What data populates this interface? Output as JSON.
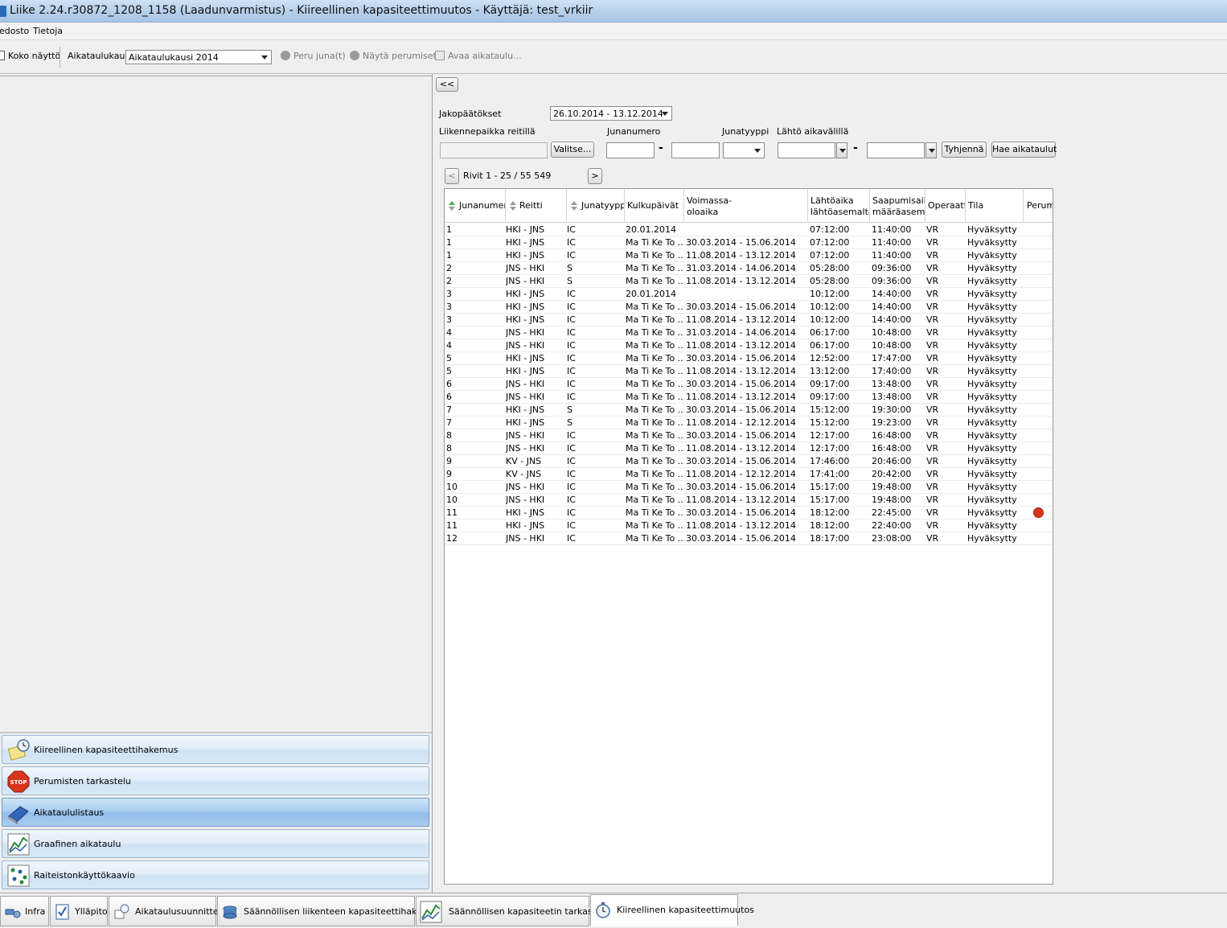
{
  "window": {
    "title": "Liike 2.24.r30872_1208_1158 (Laadunvarmistus) - Kiireellinen kapasiteettimuutos - Käyttäjä: test_vrkiir"
  },
  "menu": {
    "items": [
      "edosto",
      "Tietoja"
    ]
  },
  "toolbar": {
    "fullscreen_label": "Koko näyttö",
    "season_label": "Aikataulukausi",
    "season_value": "Aikataulukausi 2014",
    "cancel_train_label": "Peru juna(t)",
    "show_cancellations_label": "Näytä perumiset",
    "open_timetable_label": "Avaa aikataulu..."
  },
  "left_nav": {
    "items": [
      {
        "label": "Kiireellinen kapasiteettihakemus",
        "icon": "notepad-clock-icon",
        "active": false
      },
      {
        "label": "Perumisten tarkastelu",
        "icon": "stop-sign-icon",
        "active": false
      },
      {
        "label": "Aikataululistaus",
        "icon": "book-icon",
        "active": true
      },
      {
        "label": "Graafinen aikataulu",
        "icon": "graph-icon",
        "active": false
      },
      {
        "label": "Raiteistonkäyttökaavio",
        "icon": "dots-grid-icon",
        "active": false
      }
    ]
  },
  "search": {
    "collapse_label": "<<",
    "decisions_label": "Jakopäätökset",
    "decisions_value": "26.10.2014 - 13.12.2014",
    "location_label": "Liikennepaikka reitillä",
    "choose_button": "Valitse...",
    "train_number_label": "Junanumero",
    "train_type_label": "Junatyyppi",
    "departure_range_label": "Lähtö aikavälillä",
    "dash": "-",
    "clear_button": "Tyhjennä",
    "search_button": "Hae aikataulut"
  },
  "pager": {
    "prev": "<",
    "next": ">",
    "text": "Rivit 1 - 25 / 55 549"
  },
  "table": {
    "columns": [
      "Junanumero",
      "Reitti",
      "Junatyyppi",
      "Kulkupäivät",
      "Voimassa-|oloaika",
      "Lähtöaika|lähtöasemalta",
      "Saapumisaika|määräasemal",
      "Operaatto",
      "Tila",
      "Perum"
    ],
    "rows": [
      [
        "1",
        "HKI - JNS",
        "IC",
        "20.01.2014",
        "",
        "07:12:00",
        "11:40:00",
        "VR",
        "Hyväksytty",
        ""
      ],
      [
        "1",
        "HKI - JNS",
        "IC",
        "Ma Ti Ke To ...",
        "30.03.2014 - 15.06.2014",
        "07:12:00",
        "11:40:00",
        "VR",
        "Hyväksytty",
        ""
      ],
      [
        "1",
        "HKI - JNS",
        "IC",
        "Ma Ti Ke To ...",
        "11.08.2014 - 13.12.2014",
        "07:12:00",
        "11:40:00",
        "VR",
        "Hyväksytty",
        ""
      ],
      [
        "2",
        "JNS - HKI",
        "S",
        "Ma Ti Ke To ...",
        "31.03.2014 - 14.06.2014",
        "05:28:00",
        "09:36:00",
        "VR",
        "Hyväksytty",
        ""
      ],
      [
        "2",
        "JNS - HKI",
        "S",
        "Ma Ti Ke To ...",
        "11.08.2014 - 13.12.2014",
        "05:28:00",
        "09:36:00",
        "VR",
        "Hyväksytty",
        ""
      ],
      [
        "3",
        "HKI - JNS",
        "IC",
        "20.01.2014",
        "",
        "10:12:00",
        "14:40:00",
        "VR",
        "Hyväksytty",
        ""
      ],
      [
        "3",
        "HKI - JNS",
        "IC",
        "Ma Ti Ke To ...",
        "30.03.2014 - 15.06.2014",
        "10:12:00",
        "14:40:00",
        "VR",
        "Hyväksytty",
        ""
      ],
      [
        "3",
        "HKI - JNS",
        "IC",
        "Ma Ti Ke To ...",
        "11.08.2014 - 13.12.2014",
        "10:12:00",
        "14:40:00",
        "VR",
        "Hyväksytty",
        ""
      ],
      [
        "4",
        "JNS - HKI",
        "IC",
        "Ma Ti Ke To ...",
        "31.03.2014 - 14.06.2014",
        "06:17:00",
        "10:48:00",
        "VR",
        "Hyväksytty",
        ""
      ],
      [
        "4",
        "JNS - HKI",
        "IC",
        "Ma Ti Ke To ...",
        "11.08.2014 - 13.12.2014",
        "06:17:00",
        "10:48:00",
        "VR",
        "Hyväksytty",
        ""
      ],
      [
        "5",
        "HKI - JNS",
        "IC",
        "Ma Ti Ke To ...",
        "30.03.2014 - 15.06.2014",
        "12:52:00",
        "17:47:00",
        "VR",
        "Hyväksytty",
        ""
      ],
      [
        "5",
        "HKI - JNS",
        "IC",
        "Ma Ti Ke To ...",
        "11.08.2014 - 13.12.2014",
        "13:12:00",
        "17:40:00",
        "VR",
        "Hyväksytty",
        ""
      ],
      [
        "6",
        "JNS - HKI",
        "IC",
        "Ma Ti Ke To ...",
        "30.03.2014 - 15.06.2014",
        "09:17:00",
        "13:48:00",
        "VR",
        "Hyväksytty",
        ""
      ],
      [
        "6",
        "JNS - HKI",
        "IC",
        "Ma Ti Ke To ...",
        "11.08.2014 - 13.12.2014",
        "09:17:00",
        "13:48:00",
        "VR",
        "Hyväksytty",
        ""
      ],
      [
        "7",
        "HKI - JNS",
        "S",
        "Ma Ti Ke To ...",
        "30.03.2014 - 15.06.2014",
        "15:12:00",
        "19:30:00",
        "VR",
        "Hyväksytty",
        ""
      ],
      [
        "7",
        "HKI - JNS",
        "S",
        "Ma Ti Ke To ...",
        "11.08.2014 - 12.12.2014",
        "15:12:00",
        "19:23:00",
        "VR",
        "Hyväksytty",
        ""
      ],
      [
        "8",
        "JNS - HKI",
        "IC",
        "Ma Ti Ke To ...",
        "30.03.2014 - 15.06.2014",
        "12:17:00",
        "16:48:00",
        "VR",
        "Hyväksytty",
        ""
      ],
      [
        "8",
        "JNS - HKI",
        "IC",
        "Ma Ti Ke To ...",
        "11.08.2014 - 13.12.2014",
        "12:17:00",
        "16:48:00",
        "VR",
        "Hyväksytty",
        ""
      ],
      [
        "9",
        "KV - JNS",
        "IC",
        "Ma Ti Ke To ...",
        "30.03.2014 - 15.06.2014",
        "17:46:00",
        "20:46:00",
        "VR",
        "Hyväksytty",
        ""
      ],
      [
        "9",
        "KV - JNS",
        "IC",
        "Ma Ti Ke To ...",
        "11.08.2014 - 12.12.2014",
        "17:41:00",
        "20:42:00",
        "VR",
        "Hyväksytty",
        ""
      ],
      [
        "10",
        "JNS - HKI",
        "IC",
        "Ma Ti Ke To ...",
        "30.03.2014 - 15.06.2014",
        "15:17:00",
        "19:48:00",
        "VR",
        "Hyväksytty",
        ""
      ],
      [
        "10",
        "JNS - HKI",
        "IC",
        "Ma Ti Ke To ...",
        "11.08.2014 - 13.12.2014",
        "15:17:00",
        "19:48:00",
        "VR",
        "Hyväksytty",
        ""
      ],
      [
        "11",
        "HKI - JNS",
        "IC",
        "Ma Ti Ke To ...",
        "30.03.2014 - 15.06.2014",
        "18:12:00",
        "22:45:00",
        "VR",
        "Hyväksytty",
        "stop"
      ],
      [
        "11",
        "HKI - JNS",
        "IC",
        "Ma Ti Ke To ...",
        "11.08.2014 - 13.12.2014",
        "18:12:00",
        "22:40:00",
        "VR",
        "Hyväksytty",
        ""
      ],
      [
        "12",
        "JNS - HKI",
        "IC",
        "Ma Ti Ke To ...",
        "30.03.2014 - 15.06.2014",
        "18:17:00",
        "23:08:00",
        "VR",
        "Hyväksytty",
        ""
      ]
    ]
  },
  "bottom_tabs": [
    {
      "label": "Infra",
      "icon": "infra-icon"
    },
    {
      "label": "Ylläpito",
      "icon": "checklist-icon"
    },
    {
      "label": "Aikataulusuunnittelu",
      "icon": "calendar-clock-icon"
    },
    {
      "label": "Säännöllisen liikenteen kapasiteettihakemus",
      "icon": "database-icon"
    },
    {
      "label": "Säännöllisen kapasiteetin tarkastelu",
      "icon": "graph-icon"
    },
    {
      "label": "Kiireellinen kapasiteettimuutos",
      "icon": "stopwatch-icon",
      "active": true
    }
  ],
  "colors": {
    "stop_red": "#d8361c",
    "sort_active": "#3fb443",
    "nav_active": "#93bde9"
  }
}
